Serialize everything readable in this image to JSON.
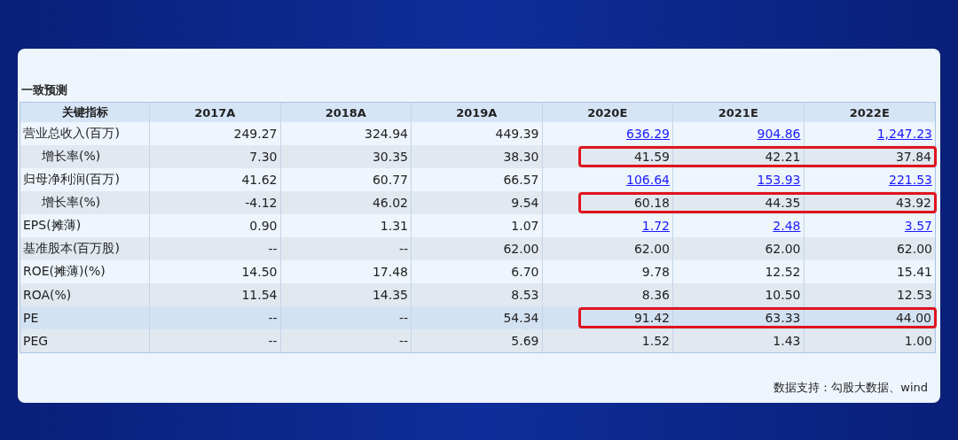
{
  "section_title": "一致预测",
  "table": {
    "columns": [
      "关键指标",
      "2017A",
      "2018A",
      "2019A",
      "2020E",
      "2021E",
      "2022E"
    ],
    "rows": [
      {
        "label": "营业总收入(百万)",
        "indented": false,
        "selected": false,
        "highlighted": false,
        "cells": [
          {
            "text": "249.27",
            "kind": "plain"
          },
          {
            "text": "324.94",
            "kind": "plain"
          },
          {
            "text": "449.39",
            "kind": "plain"
          },
          {
            "text": "636.29",
            "kind": "link"
          },
          {
            "text": "904.86",
            "kind": "link"
          },
          {
            "text": "1,247.23",
            "kind": "link"
          }
        ]
      },
      {
        "label": "增长率(%)",
        "indented": true,
        "selected": false,
        "highlighted": true,
        "cells": [
          {
            "text": "7.30",
            "kind": "plain"
          },
          {
            "text": "30.35",
            "kind": "plain"
          },
          {
            "text": "38.30",
            "kind": "plain"
          },
          {
            "text": "41.59",
            "kind": "plain"
          },
          {
            "text": "42.21",
            "kind": "plain"
          },
          {
            "text": "37.84",
            "kind": "plain"
          }
        ]
      },
      {
        "label": "归母净利润(百万)",
        "indented": false,
        "selected": false,
        "highlighted": false,
        "cells": [
          {
            "text": "41.62",
            "kind": "plain"
          },
          {
            "text": "60.77",
            "kind": "plain"
          },
          {
            "text": "66.57",
            "kind": "plain"
          },
          {
            "text": "106.64",
            "kind": "link"
          },
          {
            "text": "153.93",
            "kind": "link"
          },
          {
            "text": "221.53",
            "kind": "link"
          }
        ]
      },
      {
        "label": "增长率(%)",
        "indented": true,
        "selected": false,
        "highlighted": true,
        "cells": [
          {
            "text": "-4.12",
            "kind": "plain"
          },
          {
            "text": "46.02",
            "kind": "plain"
          },
          {
            "text": "9.54",
            "kind": "plain"
          },
          {
            "text": "60.18",
            "kind": "plain"
          },
          {
            "text": "44.35",
            "kind": "plain"
          },
          {
            "text": "43.92",
            "kind": "plain"
          }
        ]
      },
      {
        "label": "EPS(摊薄)",
        "indented": false,
        "selected": false,
        "highlighted": false,
        "cells": [
          {
            "text": "0.90",
            "kind": "plain"
          },
          {
            "text": "1.31",
            "kind": "plain"
          },
          {
            "text": "1.07",
            "kind": "plain"
          },
          {
            "text": "1.72",
            "kind": "link"
          },
          {
            "text": "2.48",
            "kind": "link"
          },
          {
            "text": "3.57",
            "kind": "link"
          }
        ]
      },
      {
        "label": "基准股本(百万股)",
        "indented": false,
        "selected": false,
        "highlighted": false,
        "cells": [
          {
            "text": "--",
            "kind": "plain"
          },
          {
            "text": "--",
            "kind": "plain"
          },
          {
            "text": "62.00",
            "kind": "plain"
          },
          {
            "text": "62.00",
            "kind": "plain"
          },
          {
            "text": "62.00",
            "kind": "plain"
          },
          {
            "text": "62.00",
            "kind": "plain"
          }
        ]
      },
      {
        "label": "ROE(摊薄)(%)",
        "indented": false,
        "selected": false,
        "highlighted": false,
        "cells": [
          {
            "text": "14.50",
            "kind": "plain"
          },
          {
            "text": "17.48",
            "kind": "plain"
          },
          {
            "text": "6.70",
            "kind": "plain"
          },
          {
            "text": "9.78",
            "kind": "plain"
          },
          {
            "text": "12.52",
            "kind": "plain"
          },
          {
            "text": "15.41",
            "kind": "plain"
          }
        ]
      },
      {
        "label": "ROA(%)",
        "indented": false,
        "selected": false,
        "highlighted": false,
        "cells": [
          {
            "text": "11.54",
            "kind": "plain"
          },
          {
            "text": "14.35",
            "kind": "plain"
          },
          {
            "text": "8.53",
            "kind": "plain"
          },
          {
            "text": "8.36",
            "kind": "plain"
          },
          {
            "text": "10.50",
            "kind": "plain"
          },
          {
            "text": "12.53",
            "kind": "plain"
          }
        ]
      },
      {
        "label": "PE",
        "indented": false,
        "selected": true,
        "highlighted": true,
        "cells": [
          {
            "text": "--",
            "kind": "plain"
          },
          {
            "text": "--",
            "kind": "plain"
          },
          {
            "text": "54.34",
            "kind": "plain"
          },
          {
            "text": "91.42",
            "kind": "plain"
          },
          {
            "text": "63.33",
            "kind": "plain"
          },
          {
            "text": "44.00",
            "kind": "plain"
          }
        ]
      },
      {
        "label": "PEG",
        "indented": false,
        "selected": false,
        "highlighted": false,
        "cells": [
          {
            "text": "--",
            "kind": "plain"
          },
          {
            "text": "--",
            "kind": "plain"
          },
          {
            "text": "5.69",
            "kind": "plain"
          },
          {
            "text": "1.52",
            "kind": "plain"
          },
          {
            "text": "1.43",
            "kind": "plain"
          },
          {
            "text": "1.00",
            "kind": "plain"
          }
        ]
      }
    ]
  },
  "source_note": "数据支持：勾股大数据、wind"
}
